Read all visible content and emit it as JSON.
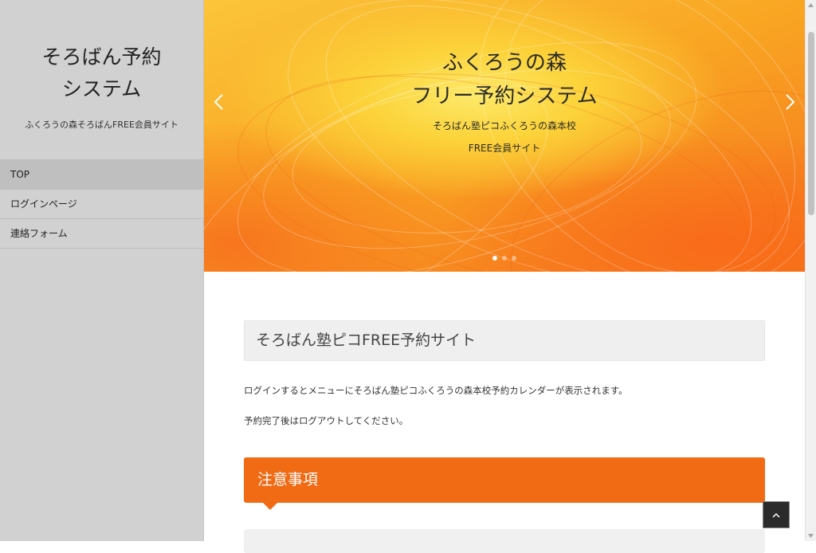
{
  "sidebar": {
    "title_line1": "そろばん予約",
    "title_line2": "システム",
    "description": "ふくろうの森そろばんFREE会員サイト",
    "nav": [
      {
        "label": "TOP"
      },
      {
        "label": "ログインページ"
      },
      {
        "label": "連絡フォーム"
      }
    ]
  },
  "hero": {
    "title_line1": "ふくろうの森",
    "title_line2": "フリー予約システム",
    "subtitle_line1": "そろばん塾ピコふくろうの森本校",
    "subtitle_line2": "FREE会員サイト",
    "prev_icon": "chevron-left-icon",
    "next_icon": "chevron-right-icon",
    "slide_count": 3,
    "active_slide": 1
  },
  "main": {
    "page_heading": "そろばん塾ピコFREE予約サイト",
    "paragraph1": "ログインするとメニューにそろばん塾ピコふくろうの森本校予約カレンダーが表示されます。",
    "paragraph2": "予約完了後はログアウトしてください。",
    "notice_heading": "注意事項"
  },
  "to_top_icon": "chevron-up-icon",
  "colors": {
    "accent": "#f16a14",
    "sidebar_bg": "#d1d1d1",
    "heading_bg": "#efefef"
  }
}
